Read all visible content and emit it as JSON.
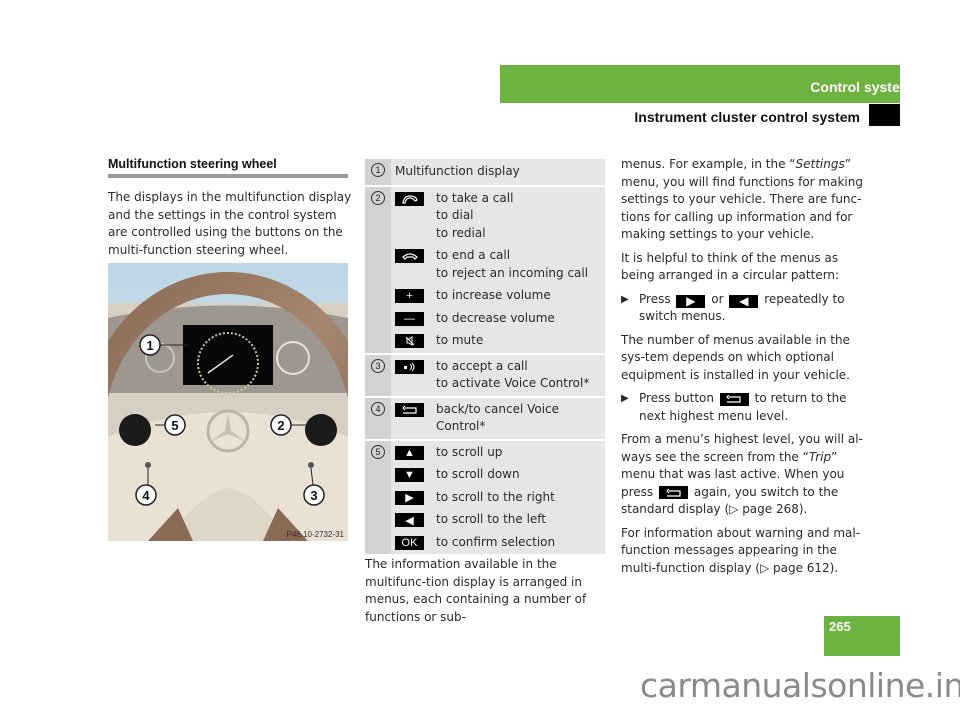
{
  "header": {
    "section": "Control systems",
    "subsection": "Instrument cluster control system",
    "accent_color": "#6db33f"
  },
  "page_number": "265",
  "watermark": "carmanualsonline.info",
  "left": {
    "heading": "Multifunction steering wheel",
    "intro": "The displays in the multifunction display and the settings in the control system are controlled using the buttons on the multi-function steering wheel.",
    "figure": {
      "code": "P46.10-2732-31",
      "callouts": [
        "1",
        "2",
        "3",
        "4",
        "5"
      ]
    }
  },
  "legend": {
    "rows": [
      {
        "num": "1",
        "items": [
          {
            "icon": "",
            "text": "Multifunction display"
          }
        ]
      },
      {
        "num": "2",
        "items": [
          {
            "icon": "phone-pickup-icon",
            "text": "to take a call\nto dial\nto redial"
          },
          {
            "icon": "phone-hangup-icon",
            "text": "to end a call\nto reject an incoming call"
          },
          {
            "icon": "plus-icon",
            "text": "to increase volume"
          },
          {
            "icon": "minus-icon",
            "text": "to decrease volume"
          },
          {
            "icon": "mute-icon",
            "text": "to mute"
          }
        ]
      },
      {
        "num": "3",
        "items": [
          {
            "icon": "voice-control-icon",
            "text": "to accept a call\nto activate Voice Control*"
          }
        ]
      },
      {
        "num": "4",
        "items": [
          {
            "icon": "back-icon",
            "text": "back/to cancel Voice Control*"
          }
        ]
      },
      {
        "num": "5",
        "items": [
          {
            "icon": "arrow-up-icon",
            "text": "to scroll up"
          },
          {
            "icon": "arrow-down-icon",
            "text": "to scroll down"
          },
          {
            "icon": "arrow-right-icon",
            "text": "to scroll to the right"
          },
          {
            "icon": "arrow-left-icon",
            "text": "to scroll to the left"
          },
          {
            "icon": "ok-icon",
            "text": "to confirm selection",
            "label": "OK"
          }
        ]
      }
    ]
  },
  "middle_bottom": "The information available in the multifunc-tion display is arranged in menus, each containing a number of functions or sub-",
  "right": {
    "p1_pre": "menus. For example, in the “",
    "p1_em": "Settings",
    "p1_post": "” menu, you will find functions for making settings to your vehicle. There are func-tions for calling up information and for making settings to your vehicle.",
    "p2": "It is helpful to think of the menus as being arranged in a circular pattern:",
    "b1_pre": "Press",
    "b1_mid": "or",
    "b1_post": "repeatedly to switch menus.",
    "p3": "The number of menus available in the sys-tem depends on which optional equipment is installed in your vehicle.",
    "b2_pre": "Press button",
    "b2_post": "to return to the next highest menu level.",
    "p4_pre": "From a menu’s highest level, you will al-ways see the screen from the “",
    "p4_em": "Trip",
    "p4_mid": "” menu that was last active. When you press",
    "p4_post": "again, you switch to the standard display (▷ page 268).",
    "p5": "For information about warning and mal-function messages appearing in the multi-function display (▷ page 612)."
  }
}
